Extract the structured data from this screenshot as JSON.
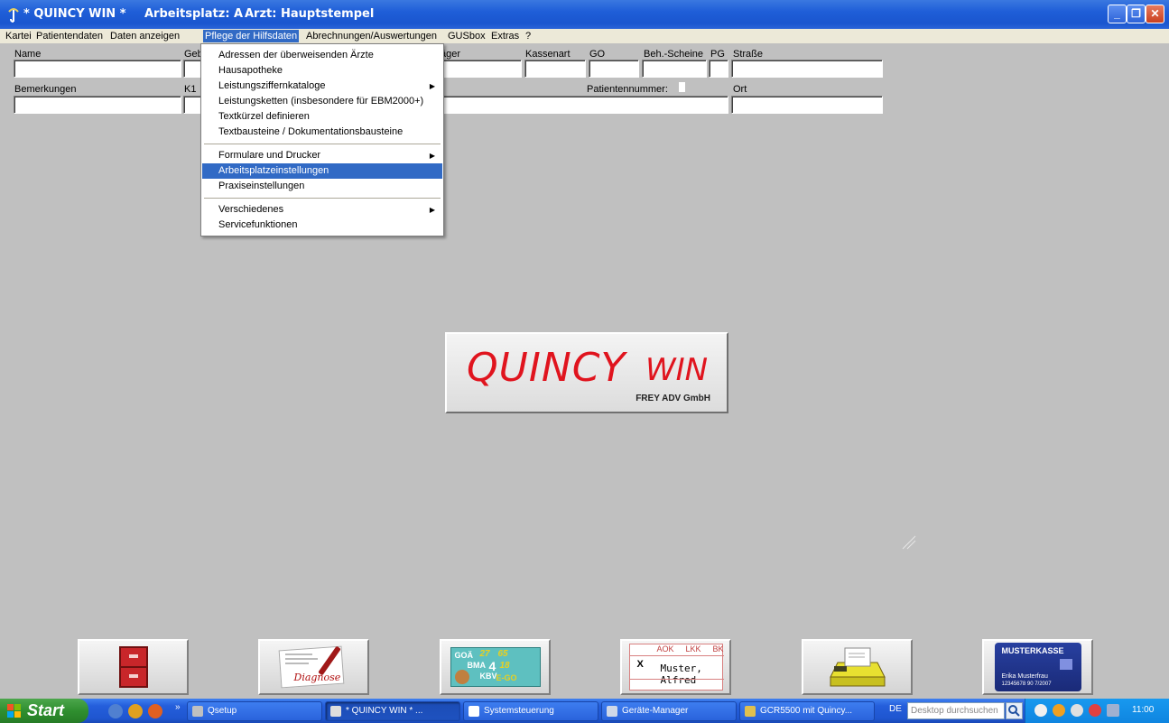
{
  "window": {
    "title": "* QUINCY WIN *",
    "workstation": "Arbeitsplatz: A",
    "doctor": "Arzt: Hauptstempel"
  },
  "menubar": [
    "Kartei",
    "Patientendaten",
    "Daten anzeigen",
    "Pflege der Hilfsdaten",
    "Abrechnungen/Auswertungen",
    "GUSbox",
    "Extras",
    "?"
  ],
  "form": {
    "name_label": "Name",
    "geb_label": "Geb",
    "traeger_label": "äger",
    "kassenart_label": "Kassenart",
    "go_label": "GO",
    "behscheine_label": "Beh.-Scheine",
    "pg_label": "PG",
    "strasse_label": "Straße",
    "bemerkungen_label": "Bemerkungen",
    "k1_label": "K1",
    "patientennummer_label": "Patientennummer:",
    "ort_label": "Ort"
  },
  "dropdown": {
    "items": [
      {
        "label": "Adressen der überweisenden Ärzte"
      },
      {
        "label": "Hausapotheke"
      },
      {
        "label": "Leistungsziffernkataloge",
        "submenu": true
      },
      {
        "label": "Leistungsketten (insbesondere für EBM2000+)"
      },
      {
        "label": "Textkürzel definieren"
      },
      {
        "label": "Textbausteine / Dokumentationsbausteine"
      },
      {
        "label": "Formulare und Drucker",
        "submenu": true
      },
      {
        "label": "Arbeitsplatzeinstellungen",
        "selected": true
      },
      {
        "label": "Praxiseinstellungen"
      },
      {
        "label": "Verschiedenes",
        "submenu": true
      },
      {
        "label": "Servicefunktionen"
      }
    ]
  },
  "logo": {
    "main": "QUINCY",
    "win": "WIN",
    "company": "FREY ADV GmbH"
  },
  "toolbar": {
    "diagnose": "Diagnose",
    "goae": "GOÄ",
    "bma": "BMA",
    "kbv": "KBV",
    "ego": "E-GO",
    "n27": "27",
    "n65": "65",
    "n4": "4",
    "n18": "18",
    "aok": "AOK",
    "lkk": "LKK",
    "bk": "BK",
    "x": "X",
    "patient": "Muster, Alfred",
    "card_title": "MUSTERKASSE",
    "card_name": "Erika Musterfrau",
    "card_nr": "12345678 90  7/2007"
  },
  "taskbar": {
    "start": "Start",
    "tasks": [
      "Qsetup",
      "* QUINCY WIN *   ...",
      "Systemsteuerung",
      "Geräte-Manager",
      "GCR5500 mit Quincy..."
    ],
    "lang": "DE",
    "search_placeholder": "Desktop durchsuchen",
    "clock": "11:00"
  },
  "colors": {
    "titlebar": "#1f5ed8",
    "menu_highlight": "#316ac5",
    "logo_red": "#e0141e",
    "background": "#c0c0c0"
  }
}
